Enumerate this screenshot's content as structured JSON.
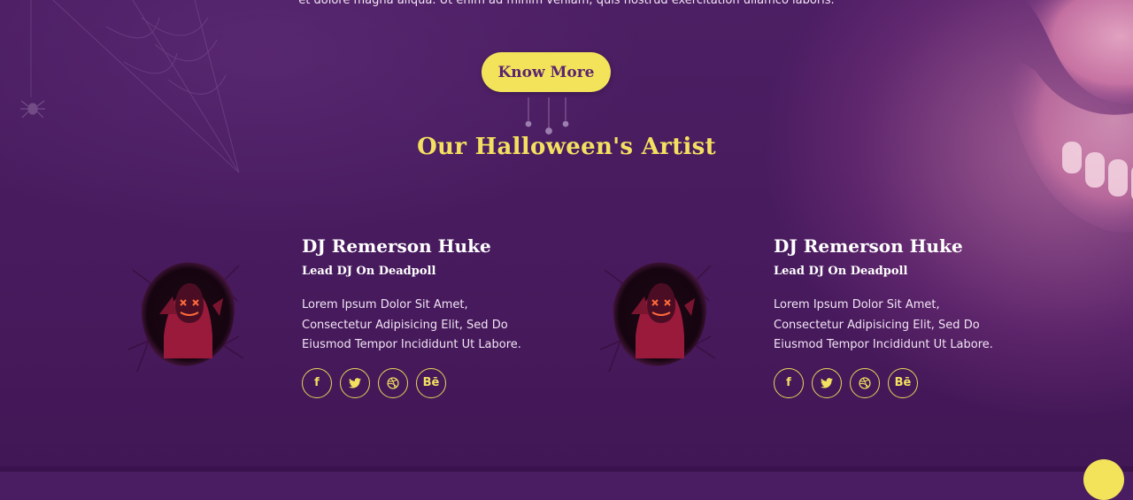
{
  "intro": {
    "text": "et dolore magna aliqua. Ut enim ad minim veniam, quis nostrud exercitation ullamco laboris."
  },
  "cta": {
    "label": "Know More"
  },
  "section": {
    "title": "Our Halloween's Artist"
  },
  "artists": [
    {
      "name": "DJ Remerson Huke",
      "role": "Lead DJ On Deadpoll",
      "description": "Lorem Ipsum Dolor Sit Amet, Consectetur Adipisicing Elit, Sed Do Eiusmod Tempor Incididunt Ut Labore.",
      "socials": [
        {
          "icon": "facebook-icon",
          "glyph": "f"
        },
        {
          "icon": "twitter-icon",
          "glyph": "🐦"
        },
        {
          "icon": "dribbble-icon",
          "glyph": "◎"
        },
        {
          "icon": "behance-icon",
          "glyph": "Bē"
        }
      ]
    },
    {
      "name": "DJ Remerson Huke",
      "role": "Lead DJ On Deadpoll",
      "description": "Lorem Ipsum Dolor Sit Amet, Consectetur Adipisicing Elit, Sed Do Eiusmod Tempor Incididunt Ut Labore.",
      "socials": [
        {
          "icon": "facebook-icon",
          "glyph": "f"
        },
        {
          "icon": "twitter-icon",
          "glyph": "🐦"
        },
        {
          "icon": "dribbble-icon",
          "glyph": "◎"
        },
        {
          "icon": "behance-icon",
          "glyph": "Bē"
        }
      ]
    }
  ],
  "colors": {
    "background": "#4a1c61",
    "accent_yellow": "#f2e35a",
    "button_text": "#5a2470",
    "social_border": "#e9d55a"
  }
}
